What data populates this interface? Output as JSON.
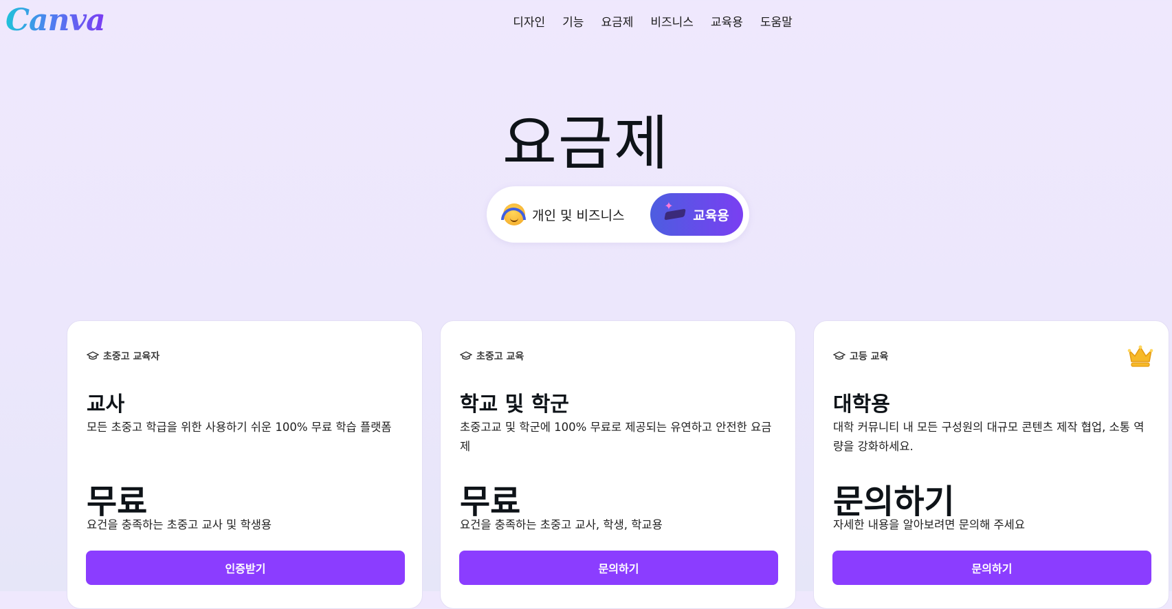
{
  "brand": {
    "logo_text": "Canva"
  },
  "nav": {
    "items": [
      "디자인",
      "기능",
      "요금제",
      "비즈니스",
      "교육용",
      "도움말"
    ]
  },
  "page": {
    "title": "요금제"
  },
  "toggle": {
    "personal_label": "개인 및 비즈니스",
    "personal_icon": "headphones-face-icon",
    "edu_label": "교육용",
    "edu_icon": "graduation-cap-icon",
    "selected": "교육용"
  },
  "colors": {
    "accent": "#8b3dff",
    "toggle_gradient_start": "#4d5de0",
    "toggle_gradient_end": "#7a3ff2"
  },
  "plans": [
    {
      "tier": "초중고 교육자",
      "name": "교사",
      "description": "모든 초중고 학급을 위한 사용하기 쉬운 100% 무료 학습 플랫폼",
      "price": "무료",
      "note": "요건을 충족하는 초중고 교사 및 학생용",
      "cta": "인증받기"
    },
    {
      "tier": "초중고 교육",
      "name": "학교 및 학군",
      "description": "초중고교 및 학군에 100% 무료로 제공되는 유연하고 안전한 요금제",
      "price": "무료",
      "note": "요건을 충족하는 초중고 교사, 학생, 학교용",
      "cta": "문의하기"
    },
    {
      "tier": "고등 교육",
      "name": "대학용",
      "description": "대학 커뮤니티 내 모든 구성원의 대규모 콘텐츠 제작 협업, 소통 역량을 강화하세요.",
      "price": "문의하기",
      "note": "자세한 내용을 알아보려면 문의해 주세요",
      "cta": "문의하기",
      "badge_icon": "crown-icon"
    }
  ]
}
